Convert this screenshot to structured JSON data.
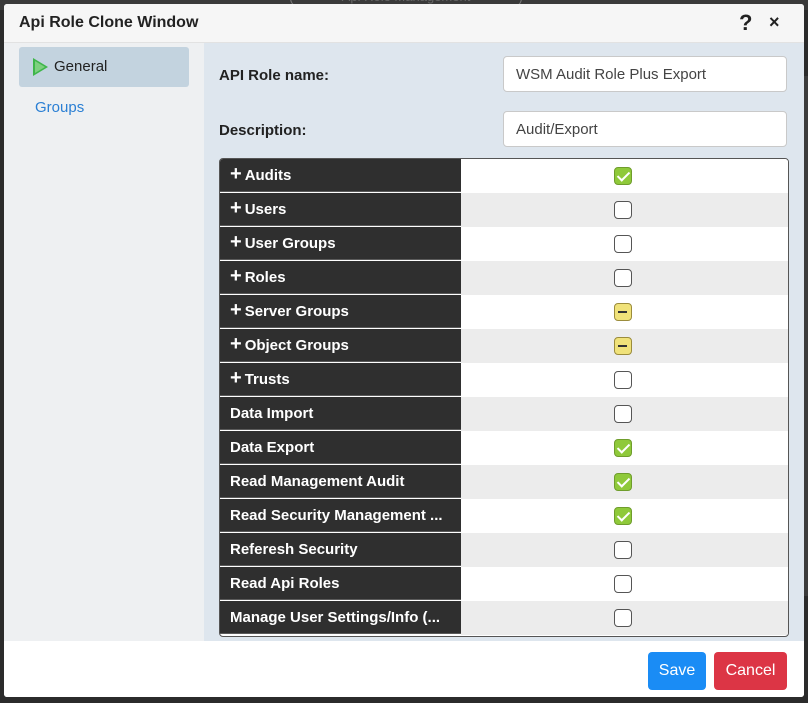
{
  "background": {
    "ghost_title": "Api Role Management"
  },
  "dialog": {
    "title": "Api Role Clone Window",
    "help_label": "?",
    "close_label": "×"
  },
  "sidebar": {
    "items": [
      {
        "label": "General",
        "active": true
      },
      {
        "label": "Groups",
        "active": false
      }
    ]
  },
  "form": {
    "name_label": "API Role name:",
    "name_value": "WSM Audit Role Plus Export",
    "description_label": "Description:",
    "description_value": "Audit/Export"
  },
  "permissions": [
    {
      "label": "Audits",
      "expandable": true,
      "state": "checked"
    },
    {
      "label": "Users",
      "expandable": true,
      "state": "unchecked"
    },
    {
      "label": "User Groups",
      "expandable": true,
      "state": "unchecked"
    },
    {
      "label": "Roles",
      "expandable": true,
      "state": "unchecked"
    },
    {
      "label": "Server Groups",
      "expandable": true,
      "state": "partial"
    },
    {
      "label": "Object Groups",
      "expandable": true,
      "state": "partial"
    },
    {
      "label": "Trusts",
      "expandable": true,
      "state": "unchecked"
    },
    {
      "label": "Data Import",
      "expandable": false,
      "state": "unchecked"
    },
    {
      "label": "Data Export",
      "expandable": false,
      "state": "checked"
    },
    {
      "label": "Read Management Audit",
      "expandable": false,
      "state": "checked"
    },
    {
      "label": "Read Security Management ...",
      "expandable": false,
      "state": "checked"
    },
    {
      "label": "Referesh Security",
      "expandable": false,
      "state": "unchecked"
    },
    {
      "label": "Read Api Roles",
      "expandable": false,
      "state": "unchecked"
    },
    {
      "label": "Manage User Settings/Info (...",
      "expandable": false,
      "state": "unchecked"
    }
  ],
  "footer": {
    "save_label": "Save",
    "cancel_label": "Cancel"
  },
  "colors": {
    "accent": "#1a8cf5",
    "danger": "#dc3545",
    "checked": "#8fc93a",
    "partial": "#f0e27a"
  }
}
